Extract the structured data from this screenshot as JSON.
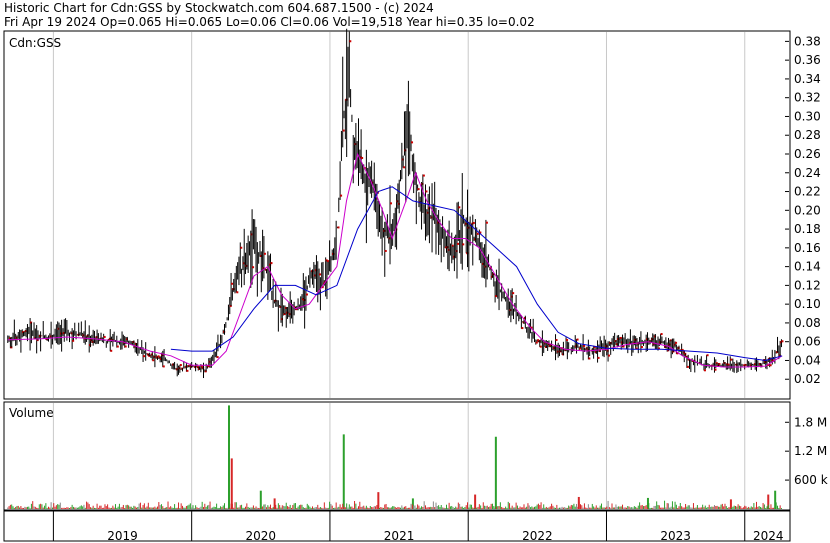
{
  "header": {
    "line1": "Historic Chart for Cdn:GSS by Stockwatch.com 604.687.1500 - (c) 2024",
    "line2": "Fri Apr 19 2024   Op=0.065  Hi=0.065  Lo=0.06  Cl=0.06  Vol=19,518  Year hi=0.35  lo=0.02"
  },
  "price_panel": {
    "title": "Cdn:GSS"
  },
  "volume_panel": {
    "title": "Volume"
  },
  "colors": {
    "price_bar": "#000000",
    "up_volume": "#2ca02c",
    "down_volume": "#d62728",
    "flat_volume": "#888888",
    "ma_short": "#cc00cc",
    "ma_long": "#0000cc",
    "close_marker": "#cc0000"
  },
  "chart_data": [
    {
      "type": "line",
      "panel": "price",
      "title": "Cdn:GSS",
      "ylim": [
        0.0,
        0.39
      ],
      "y_ticks": [
        "0.02",
        "0.04",
        "0.06",
        "0.08",
        "0.10",
        "0.12",
        "0.14",
        "0.16",
        "0.18",
        "0.20",
        "0.22",
        "0.24",
        "0.26",
        "0.28",
        "0.30",
        "0.32",
        "0.34",
        "0.36",
        "0.38"
      ],
      "x_ticks": [
        "2019",
        "2020",
        "2021",
        "2022",
        "2023",
        "2024"
      ],
      "xlim": [
        2018.65,
        2024.32
      ],
      "series": [
        {
          "kind": "price_high_low",
          "points": [
            [
              2018.67,
              0.06
            ],
            [
              2018.8,
              0.07
            ],
            [
              2018.95,
              0.065
            ],
            [
              2019.1,
              0.07
            ],
            [
              2019.25,
              0.065
            ],
            [
              2019.4,
              0.06
            ],
            [
              2019.55,
              0.06
            ],
            [
              2019.7,
              0.045
            ],
            [
              2019.82,
              0.04
            ],
            [
              2019.9,
              0.03
            ],
            [
              2020.0,
              0.035
            ],
            [
              2020.1,
              0.03
            ],
            [
              2020.2,
              0.055
            ],
            [
              2020.27,
              0.09
            ],
            [
              2020.32,
              0.13
            ],
            [
              2020.38,
              0.14
            ],
            [
              2020.44,
              0.16
            ],
            [
              2020.5,
              0.15
            ],
            [
              2020.55,
              0.13
            ],
            [
              2020.6,
              0.1
            ],
            [
              2020.7,
              0.09
            ],
            [
              2020.8,
              0.1
            ],
            [
              2020.88,
              0.14
            ],
            [
              2020.95,
              0.12
            ],
            [
              2021.0,
              0.14
            ],
            [
              2021.05,
              0.17
            ],
            [
              2021.1,
              0.3
            ],
            [
              2021.14,
              0.33
            ],
            [
              2021.18,
              0.26
            ],
            [
              2021.22,
              0.25
            ],
            [
              2021.28,
              0.23
            ],
            [
              2021.33,
              0.22
            ],
            [
              2021.38,
              0.18
            ],
            [
              2021.45,
              0.17
            ],
            [
              2021.52,
              0.25
            ],
            [
              2021.57,
              0.28
            ],
            [
              2021.62,
              0.23
            ],
            [
              2021.68,
              0.2
            ],
            [
              2021.75,
              0.19
            ],
            [
              2021.82,
              0.17
            ],
            [
              2021.9,
              0.16
            ],
            [
              2021.97,
              0.19
            ],
            [
              2022.05,
              0.17
            ],
            [
              2022.12,
              0.15
            ],
            [
              2022.2,
              0.12
            ],
            [
              2022.3,
              0.1
            ],
            [
              2022.4,
              0.08
            ],
            [
              2022.5,
              0.06
            ],
            [
              2022.6,
              0.055
            ],
            [
              2022.7,
              0.05
            ],
            [
              2022.8,
              0.055
            ],
            [
              2022.9,
              0.05
            ],
            [
              2023.0,
              0.055
            ],
            [
              2023.1,
              0.06
            ],
            [
              2023.2,
              0.06
            ],
            [
              2023.3,
              0.06
            ],
            [
              2023.4,
              0.06
            ],
            [
              2023.5,
              0.055
            ],
            [
              2023.6,
              0.04
            ],
            [
              2023.7,
              0.035
            ],
            [
              2023.8,
              0.035
            ],
            [
              2023.9,
              0.035
            ],
            [
              2024.0,
              0.035
            ],
            [
              2024.1,
              0.035
            ],
            [
              2024.2,
              0.04
            ],
            [
              2024.27,
              0.06
            ]
          ]
        },
        {
          "kind": "moving_average_short",
          "points": [
            [
              2018.67,
              0.062
            ],
            [
              2018.9,
              0.063
            ],
            [
              2019.1,
              0.065
            ],
            [
              2019.3,
              0.063
            ],
            [
              2019.5,
              0.06
            ],
            [
              2019.7,
              0.05
            ],
            [
              2019.85,
              0.045
            ],
            [
              2020.0,
              0.035
            ],
            [
              2020.15,
              0.035
            ],
            [
              2020.25,
              0.05
            ],
            [
              2020.35,
              0.09
            ],
            [
              2020.45,
              0.13
            ],
            [
              2020.55,
              0.14
            ],
            [
              2020.65,
              0.11
            ],
            [
              2020.75,
              0.095
            ],
            [
              2020.85,
              0.1
            ],
            [
              2020.95,
              0.12
            ],
            [
              2021.05,
              0.14
            ],
            [
              2021.12,
              0.21
            ],
            [
              2021.2,
              0.26
            ],
            [
              2021.3,
              0.23
            ],
            [
              2021.38,
              0.2
            ],
            [
              2021.45,
              0.17
            ],
            [
              2021.55,
              0.21
            ],
            [
              2021.62,
              0.24
            ],
            [
              2021.7,
              0.21
            ],
            [
              2021.78,
              0.19
            ],
            [
              2021.88,
              0.17
            ],
            [
              2021.98,
              0.17
            ],
            [
              2022.08,
              0.16
            ],
            [
              2022.2,
              0.13
            ],
            [
              2022.32,
              0.1
            ],
            [
              2022.45,
              0.075
            ],
            [
              2022.55,
              0.06
            ],
            [
              2022.7,
              0.052
            ],
            [
              2022.85,
              0.05
            ],
            [
              2023.0,
              0.052
            ],
            [
              2023.15,
              0.057
            ],
            [
              2023.3,
              0.06
            ],
            [
              2023.45,
              0.055
            ],
            [
              2023.55,
              0.045
            ],
            [
              2023.7,
              0.035
            ],
            [
              2023.85,
              0.033
            ],
            [
              2024.0,
              0.033
            ],
            [
              2024.15,
              0.034
            ],
            [
              2024.27,
              0.045
            ]
          ]
        },
        {
          "kind": "moving_average_long",
          "points": [
            [
              2019.85,
              0.052
            ],
            [
              2020.0,
              0.05
            ],
            [
              2020.15,
              0.05
            ],
            [
              2020.3,
              0.065
            ],
            [
              2020.45,
              0.095
            ],
            [
              2020.6,
              0.12
            ],
            [
              2020.75,
              0.12
            ],
            [
              2020.9,
              0.11
            ],
            [
              2021.05,
              0.12
            ],
            [
              2021.2,
              0.18
            ],
            [
              2021.35,
              0.22
            ],
            [
              2021.45,
              0.225
            ],
            [
              2021.6,
              0.21
            ],
            [
              2021.75,
              0.205
            ],
            [
              2021.9,
              0.2
            ],
            [
              2022.05,
              0.18
            ],
            [
              2022.2,
              0.16
            ],
            [
              2022.35,
              0.14
            ],
            [
              2022.5,
              0.1
            ],
            [
              2022.65,
              0.07
            ],
            [
              2022.8,
              0.058
            ],
            [
              2023.0,
              0.053
            ],
            [
              2023.2,
              0.052
            ],
            [
              2023.4,
              0.052
            ],
            [
              2023.6,
              0.05
            ],
            [
              2023.8,
              0.048
            ],
            [
              2024.0,
              0.043
            ],
            [
              2024.15,
              0.04
            ],
            [
              2024.27,
              0.045
            ]
          ]
        }
      ]
    },
    {
      "type": "bar",
      "panel": "volume",
      "title": "Volume",
      "ylim": [
        0,
        2200000
      ],
      "y_ticks": [
        "600 k",
        "1.2 M",
        "1.8 M"
      ],
      "x_ticks": [
        "2019",
        "2020",
        "2021",
        "2022",
        "2023",
        "2024"
      ],
      "series": [
        {
          "name": "",
          "points": [
            [
              2020.27,
              2150000
            ],
            [
              2020.29,
              1050000
            ],
            [
              2021.1,
              1550000
            ],
            [
              2021.35,
              350000
            ],
            [
              2022.2,
              1500000
            ],
            [
              2022.05,
              300000
            ],
            [
              2020.5,
              380000
            ],
            [
              2020.6,
              220000
            ],
            [
              2021.6,
              220000
            ],
            [
              2022.8,
              250000
            ],
            [
              2023.3,
              230000
            ],
            [
              2024.17,
              300000
            ],
            [
              2024.22,
              380000
            ],
            [
              2023.9,
              200000
            ]
          ]
        }
      ]
    }
  ]
}
